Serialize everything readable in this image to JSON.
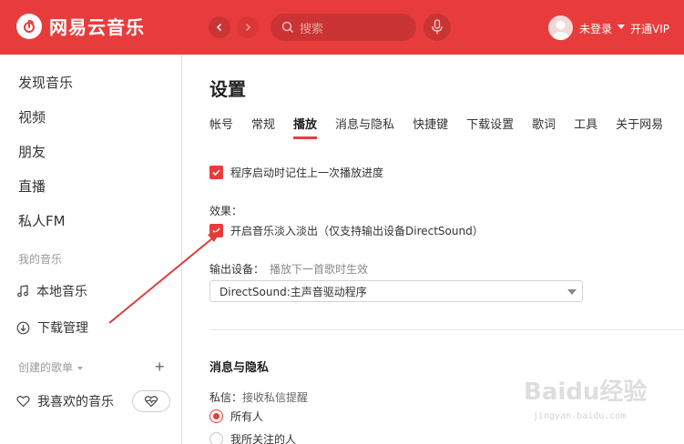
{
  "app": {
    "name": "网易云音乐",
    "brand_color": "#e83c3c"
  },
  "header": {
    "search_placeholder": "搜索",
    "login_text": "未登录",
    "vip_text": "开通VIP"
  },
  "sidebar": {
    "items": [
      {
        "label": "发现音乐"
      },
      {
        "label": "视频"
      },
      {
        "label": "朋友"
      },
      {
        "label": "直播"
      },
      {
        "label": "私人FM"
      }
    ],
    "my_music_title": "我的音乐",
    "my_music": [
      {
        "label": "本地音乐",
        "icon": "music-note-icon"
      },
      {
        "label": "下载管理",
        "icon": "download-icon"
      }
    ],
    "created_playlists_title": "创建的歌单",
    "liked_playlist": {
      "label": "我喜欢的音乐",
      "icon": "heart-icon"
    }
  },
  "main": {
    "title": "设置",
    "tabs": [
      {
        "label": "帐号"
      },
      {
        "label": "常规"
      },
      {
        "label": "播放",
        "active": true
      },
      {
        "label": "消息与隐私"
      },
      {
        "label": "快捷键"
      },
      {
        "label": "下载设置"
      },
      {
        "label": "歌词"
      },
      {
        "label": "工具"
      },
      {
        "label": "关于网易"
      }
    ],
    "resume_progress": {
      "label": "程序启动时记住上一次播放进度",
      "checked": true
    },
    "effects_label": "效果：",
    "fade": {
      "label": "开启音乐淡入淡出（仅支持输出设备DirectSound）",
      "checked": true
    },
    "output_device_label": "输出设备：",
    "output_device_hint": "播放下一首歌时生效",
    "output_device_value": "DirectSound:主声音驱动程序",
    "privacy_title": "消息与隐私",
    "private_msg_label": "私信：",
    "private_msg_hint": "接收私信提醒",
    "private_options": [
      {
        "label": "所有人",
        "selected": true
      },
      {
        "label": "我所关注的人",
        "selected": false
      }
    ]
  },
  "watermark": {
    "main": "Baidu经验",
    "sub": "jingyan.baidu.com"
  }
}
